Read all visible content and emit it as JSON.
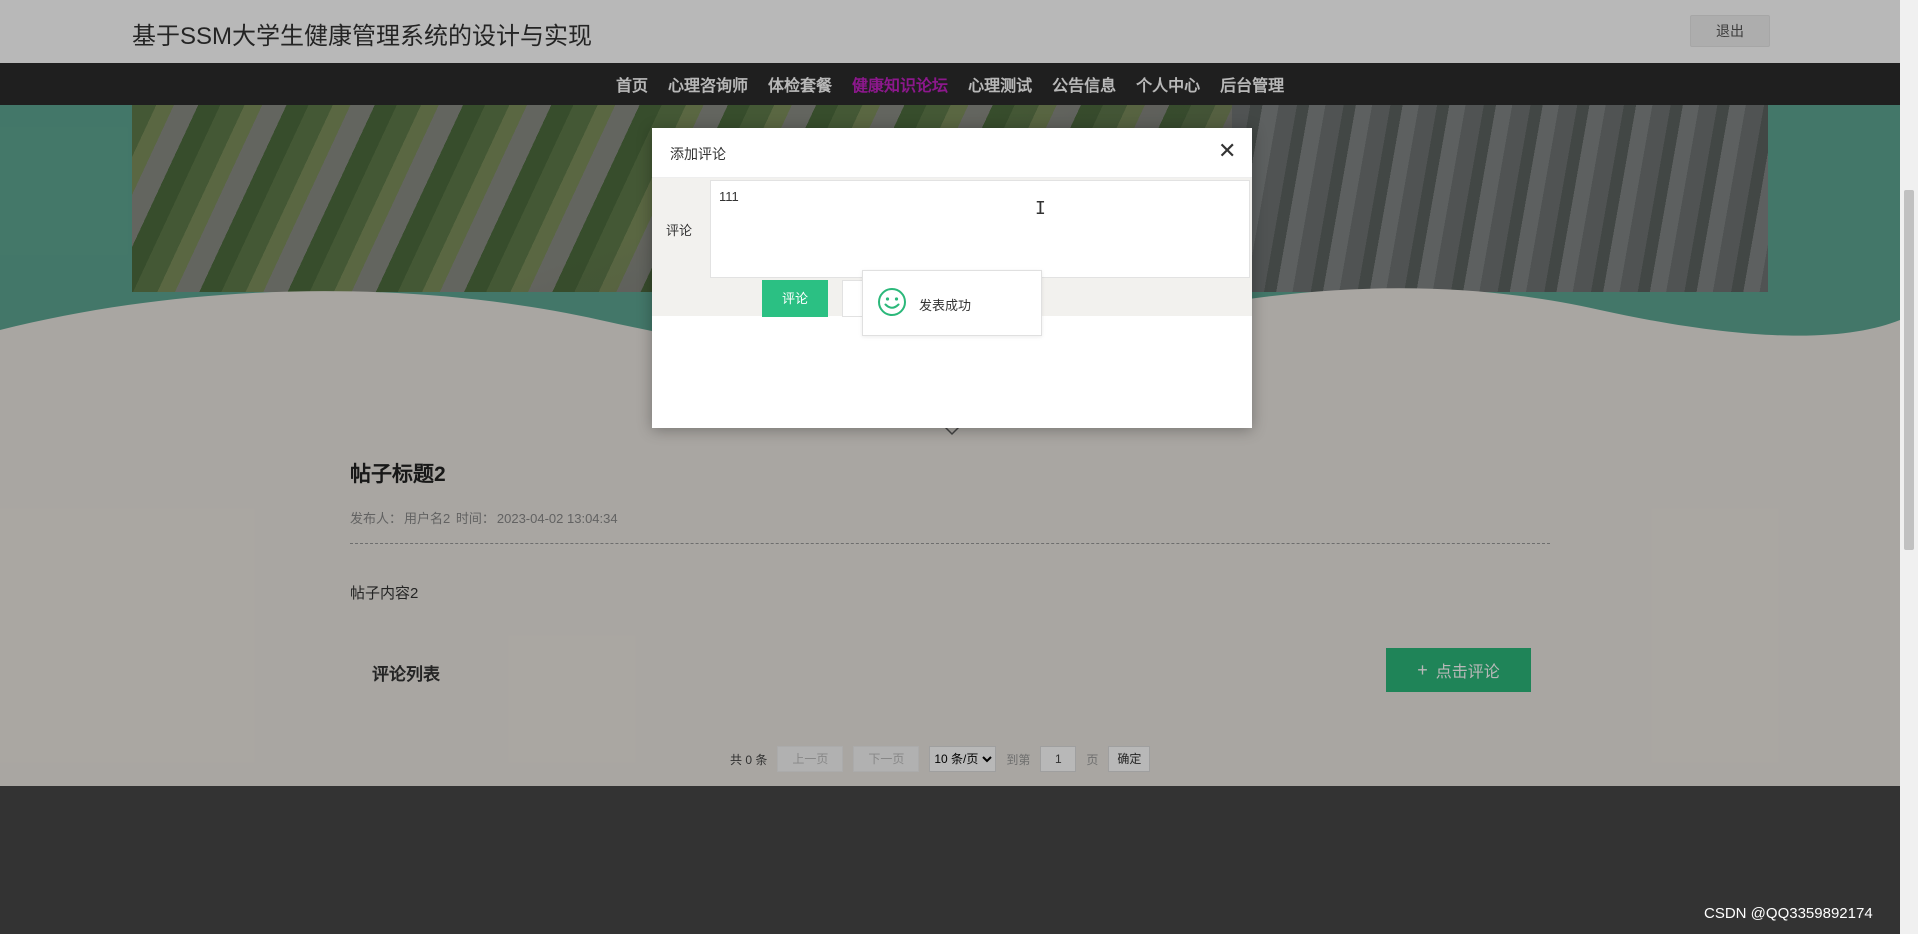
{
  "header": {
    "site_title": "基于SSM大学生健康管理系统的设计与实现",
    "logout_label": "退出"
  },
  "nav": {
    "items": [
      {
        "label": "首页",
        "active": false
      },
      {
        "label": "心理咨询师",
        "active": false
      },
      {
        "label": "体检套餐",
        "active": false
      },
      {
        "label": "健康知识论坛",
        "active": true
      },
      {
        "label": "心理测试",
        "active": false
      },
      {
        "label": "公告信息",
        "active": false
      },
      {
        "label": "个人中心",
        "active": false
      },
      {
        "label": "后台管理",
        "active": false
      }
    ],
    "active_color": "#c322c3"
  },
  "post": {
    "title": "帖子标题2",
    "meta_publisher_label": "发布人：",
    "meta_publisher": "用户名2",
    "meta_time_label": "时间：",
    "meta_time": "2023-04-02 13:04:34",
    "content": "帖子内容2"
  },
  "comments": {
    "list_title": "评论列表",
    "add_button_label": "点击评论",
    "add_button_icon": "plus-icon",
    "accent_color": "#2bb87a"
  },
  "pagination": {
    "total_text": "共 0 条",
    "prev_label": "上一页",
    "next_label": "下一页",
    "page_size_selected": "10 条/页",
    "goto_label": "到第",
    "page_input": "1",
    "page_unit": "页",
    "confirm_label": "确定"
  },
  "modal": {
    "title": "添加评论",
    "close_icon": "close-icon",
    "field_label": "评论",
    "textarea_value": "111",
    "submit_label": "评论"
  },
  "toast": {
    "icon": "smile-icon",
    "message": "发表成功"
  },
  "watermark": "CSDN @QQ3359892174"
}
